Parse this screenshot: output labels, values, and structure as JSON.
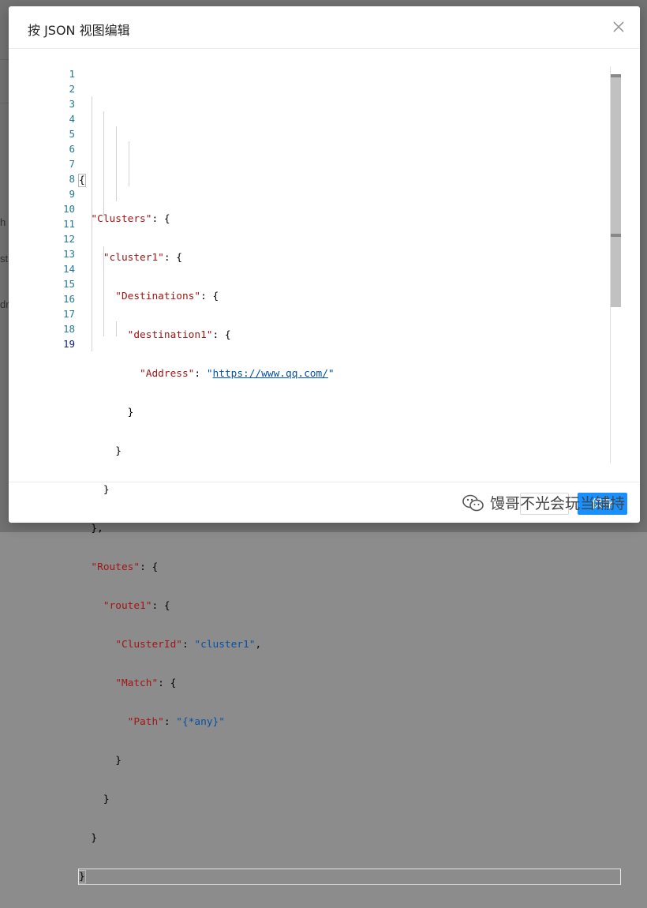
{
  "dialog": {
    "title": "按 JSON 视图编辑",
    "close_icon": "close-icon"
  },
  "background": {
    "fragments": [
      "h",
      "st",
      "dr"
    ]
  },
  "editor": {
    "line_numbers": [
      "1",
      "2",
      "3",
      "4",
      "5",
      "6",
      "7",
      "8",
      "9",
      "10",
      "11",
      "12",
      "13",
      "14",
      "15",
      "16",
      "17",
      "18",
      "19"
    ],
    "active_line": 19,
    "json": {
      "clusters_key": "\"Clusters\"",
      "cluster1_key": "\"cluster1\"",
      "destinations_key": "\"Destinations\"",
      "destination1_key": "\"destination1\"",
      "address_key": "\"Address\"",
      "address_value": "https://www.qq.com/",
      "routes_key": "\"Routes\"",
      "route1_key": "\"route1\"",
      "clusterid_key": "\"ClusterId\"",
      "clusterid_value": "\"cluster1\"",
      "match_key": "\"Match\"",
      "path_key": "\"Path\"",
      "path_value": "\"{*any}\""
    }
  },
  "footer": {
    "save_label": "保存",
    "watermark_text": "馒哥不光会玩当铺持"
  },
  "colors": {
    "accent": "#1890ff",
    "key": "#a31515",
    "string": "#0451a5",
    "line_number": "#237893"
  }
}
